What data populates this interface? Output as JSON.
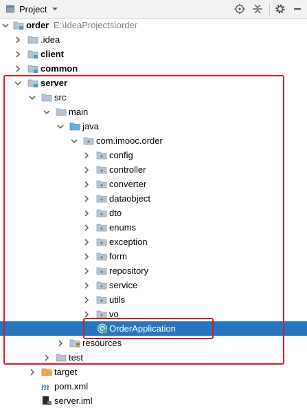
{
  "toolbar": {
    "title": "Project",
    "icons": [
      "project-panel-icon",
      "dropdown-chevron-icon",
      "locate-target-icon",
      "collapse-all-icon",
      "gear-icon",
      "hide-panel-icon"
    ]
  },
  "tree": {
    "root_label": "order",
    "root_path": "E:\\IdeaProjects\\order",
    "idea_label": ".idea",
    "client_label": "client",
    "common_label": "common",
    "server_label": "server",
    "src_label": "src",
    "main_label": "main",
    "java_label": "java",
    "package_label": "com.imooc.order",
    "packages": [
      "config",
      "controller",
      "converter",
      "dataobject",
      "dto",
      "enums",
      "exception",
      "form",
      "repository",
      "service",
      "utils",
      "vo"
    ],
    "selected_class": "OrderApplication",
    "resources_label": "resources",
    "test_label": "test",
    "target_label": "target",
    "pom_label": "pom.xml",
    "iml_label": "server.iml"
  },
  "colors": {
    "selection": "#2675bf",
    "highlight_box": "#e0191d",
    "folder": "#b7c4d1",
    "source_folder": "#68b0e3",
    "excluded_folder": "#f3a256",
    "module_marker": "#3ea0cc"
  }
}
